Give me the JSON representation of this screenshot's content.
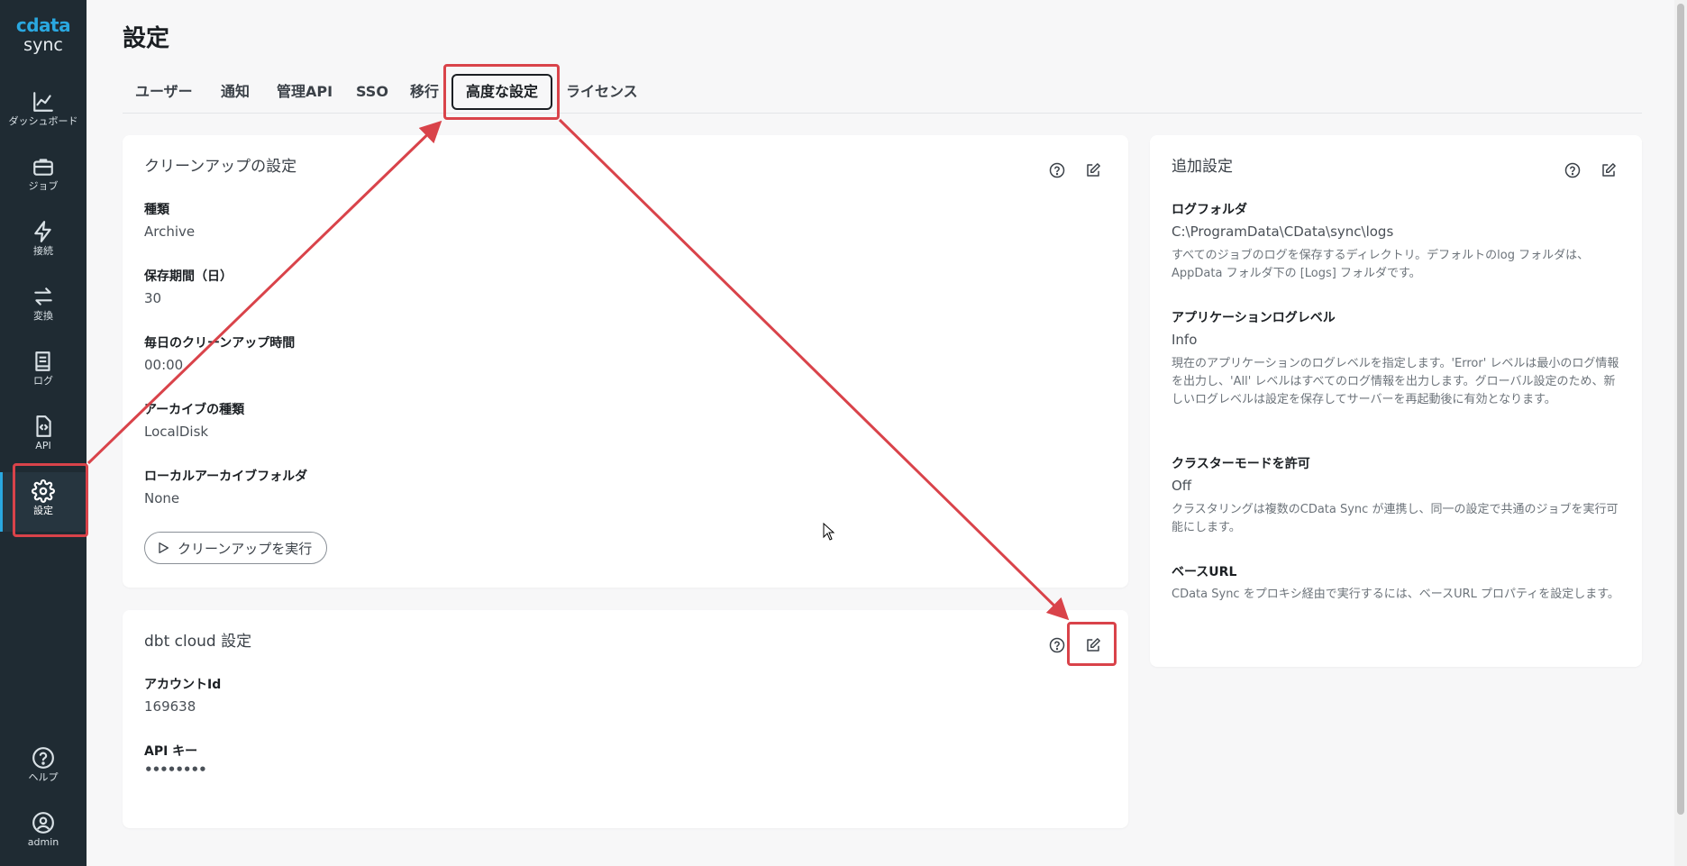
{
  "app": {
    "brand": "cdata",
    "product": "sync"
  },
  "sidebar": {
    "items": [
      {
        "label": "ダッシュボード",
        "icon": "chart-line-icon"
      },
      {
        "label": "ジョブ",
        "icon": "briefcase-icon"
      },
      {
        "label": "接続",
        "icon": "lightning-icon"
      },
      {
        "label": "変換",
        "icon": "arrows-swap-icon"
      },
      {
        "label": "ログ",
        "icon": "book-icon"
      },
      {
        "label": "API",
        "icon": "code-file-icon"
      },
      {
        "label": "設定",
        "icon": "gear-icon",
        "active": true
      }
    ],
    "bottom": [
      {
        "label": "ヘルプ",
        "icon": "help-circle-icon"
      },
      {
        "label": "admin",
        "icon": "user-circle-icon"
      }
    ]
  },
  "page": {
    "title": "設定"
  },
  "tabs": [
    "ユーザー",
    "通知",
    "管理API",
    "SSO",
    "移行",
    "高度な設定",
    "ライセンス"
  ],
  "active_tab": "高度な設定",
  "cleanup": {
    "title": "クリーンアップの設定",
    "fields": [
      {
        "label": "種類",
        "value": "Archive"
      },
      {
        "label": "保存期間（日）",
        "value": "30"
      },
      {
        "label": "毎日のクリーンアップ時間",
        "value": "00:00"
      },
      {
        "label": "アーカイブの種類",
        "value": "LocalDisk"
      },
      {
        "label": "ローカルアーカイブフォルダ",
        "value": "None"
      }
    ],
    "run_button": "クリーンアップを実行"
  },
  "dbt": {
    "title": "dbt cloud 設定",
    "fields": [
      {
        "label": "アカウントId",
        "value": "169638"
      },
      {
        "label": "API キー",
        "value": "••••••••"
      }
    ]
  },
  "additional": {
    "title": "追加設定",
    "fields": [
      {
        "label": "ログフォルダ",
        "value": "C:\\ProgramData\\CData\\sync\\logs",
        "desc": "すべてのジョブのログを保存するディレクトリ。デフォルトのlog フォルダは、AppData フォルダ下の [Logs] フォルダです。"
      },
      {
        "label": "アプリケーションログレベル",
        "value": "Info",
        "desc": "現在のアプリケーションのログレベルを指定します。'Error' レベルは最小のログ情報を出力し、'All' レベルはすべてのログ情報を出力します。グローバル設定のため、新しいログレベルは設定を保存してサーバーを再起動後に有効となります。"
      },
      {
        "label": "クラスターモードを許可",
        "value": "Off",
        "desc": "クラスタリングは複数のCData Sync が連携し、同一の設定で共通のジョブを実行可能にします。"
      },
      {
        "label": "ベースURL",
        "value": "",
        "desc": "CData Sync をプロキシ経由で実行するには、ベースURL プロパティを設定します。"
      }
    ]
  },
  "colors": {
    "sidebar_bg": "#1f2b33",
    "accent": "#2aa8e0",
    "annotation": "#d9434a"
  }
}
